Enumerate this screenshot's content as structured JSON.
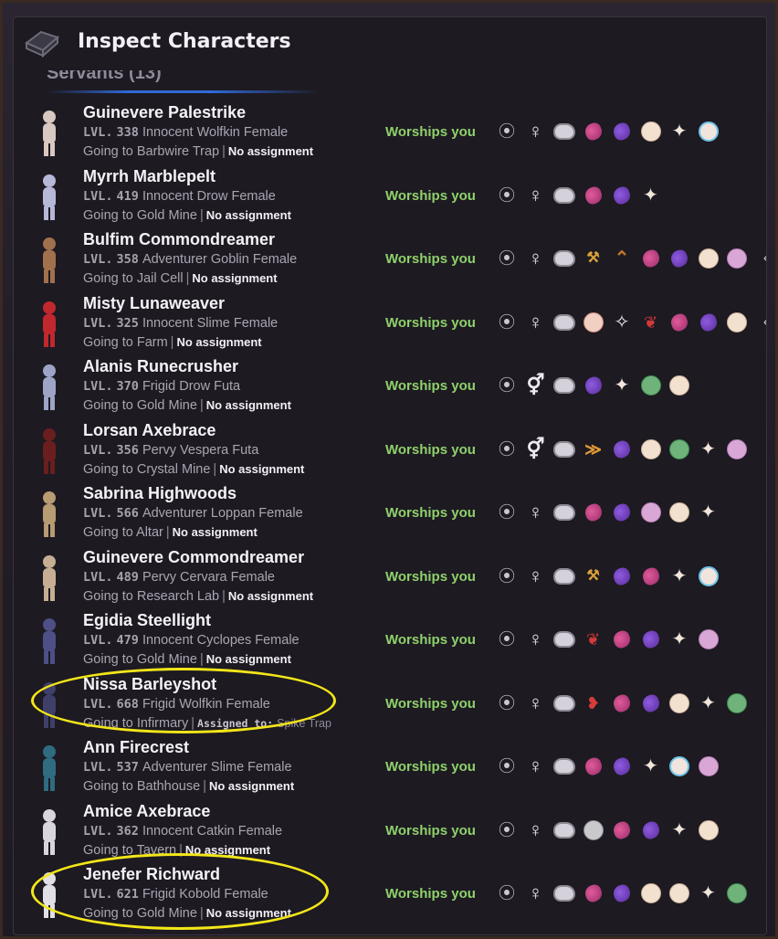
{
  "header": {
    "title": "Inspect Characters",
    "section_title": "Servants (13)"
  },
  "labels": {
    "lvl_prefix": "LVL.",
    "worships": "Worships you",
    "assigned_to_key": "Assigned to:",
    "separator": "|"
  },
  "colors": {
    "worships_green": "#8fd16a",
    "highlight_yellow": "#f3e619",
    "accent_blue": "#2f6ad8"
  },
  "servants": [
    {
      "name": "Guinevere Palestrike",
      "level": "338",
      "type": "Innocent Wolfkin Female",
      "going": "Going to Barbwire Trap",
      "assignment": "No assignment",
      "worship": "Worships you",
      "icons": [
        "mask-icon",
        "venus-icon",
        "brain-icon",
        "pink-heart-icon",
        "purple-heart-icon",
        "face-icon",
        "figure-icon",
        "crying-face-icon"
      ]
    },
    {
      "name": "Myrrh Marblepelt",
      "level": "419",
      "type": "Innocent Drow Female",
      "going": "Going to Gold Mine",
      "assignment": "No assignment",
      "worship": "Worships you",
      "icons": [
        "mask-icon",
        "venus-icon",
        "brain-icon",
        "pink-heart-icon",
        "purple-heart-icon",
        "figure-icon"
      ]
    },
    {
      "name": "Bulfim Commondreamer",
      "level": "358",
      "type": "Adventurer Goblin Female",
      "going": "Going to Jail Cell",
      "assignment": "No assignment",
      "worship": "Worships you",
      "icons": [
        "mask-icon",
        "venus-icon",
        "brain-icon",
        "axes-icon",
        "axes-chevron-icon",
        "pink-heart-icon",
        "purple-heart-icon",
        "face-icon",
        "pink-face-icon",
        "arrow-icon"
      ]
    },
    {
      "name": "Misty Lunaweaver",
      "level": "325",
      "type": "Innocent Slime Female",
      "going": "Going to Farm",
      "assignment": "No assignment",
      "worship": "Worships you",
      "icons": [
        "mask-icon",
        "venus-icon",
        "brain-icon",
        "angry-face-icon",
        "sparkle-icon",
        "rose-icon",
        "pink-heart-icon",
        "purple-heart-icon",
        "face-icon",
        "arrow-icon"
      ]
    },
    {
      "name": "Alanis Runecrusher",
      "level": "370",
      "type": "Frigid Drow Futa",
      "going": "Going to Gold Mine",
      "assignment": "No assignment",
      "worship": "Worships you",
      "icons": [
        "mask-icon",
        "futa-icon",
        "brain-icon",
        "purple-heart-icon",
        "figure-icon",
        "green-face-icon",
        "face-icon"
      ]
    },
    {
      "name": "Lorsan Axebrace",
      "level": "356",
      "type": "Pervy Vespera Futa",
      "going": "Going to Crystal Mine",
      "assignment": "No assignment",
      "worship": "Worships you",
      "icons": [
        "mask-icon",
        "futa-icon",
        "brain-icon",
        "rank-chevron-icon",
        "purple-heart-icon",
        "face-icon",
        "green-face-icon",
        "figure-icon",
        "pink-face-icon"
      ]
    },
    {
      "name": "Sabrina Highwoods",
      "level": "566",
      "type": "Adventurer Loppan Female",
      "going": "Going to Altar",
      "assignment": "No assignment",
      "worship": "Worships you",
      "icons": [
        "mask-icon",
        "venus-icon",
        "brain-icon",
        "pink-heart-icon",
        "purple-heart-icon",
        "pink-face-icon",
        "face-icon",
        "figure-icon"
      ]
    },
    {
      "name": "Guinevere Commondreamer",
      "level": "489",
      "type": "Pervy Cervara Female",
      "going": "Going to Research Lab",
      "assignment": "No assignment",
      "worship": "Worships you",
      "icons": [
        "mask-icon",
        "venus-icon",
        "brain-icon",
        "axes-icon",
        "purple-heart-icon",
        "pink-heart-icon",
        "figure-icon",
        "crying-face-icon"
      ]
    },
    {
      "name": "Egidia Steellight",
      "level": "479",
      "type": "Innocent Cyclopes Female",
      "going": "Going to Gold Mine",
      "assignment": "No assignment",
      "worship": "Worships you",
      "icons": [
        "mask-icon",
        "venus-icon",
        "brain-icon",
        "rose-icon",
        "pink-heart-icon",
        "purple-heart-icon",
        "figure-icon",
        "pink-face-icon"
      ]
    },
    {
      "name": "Nissa Barleyshot",
      "level": "668",
      "type": "Frigid Wolfkin Female",
      "going": "Going to Infirmary",
      "assignment": "Spike Trap",
      "assigned": true,
      "worship": "Worships you",
      "icons": [
        "mask-icon",
        "venus-icon",
        "brain-icon",
        "lips-icon",
        "pink-heart-icon",
        "purple-heart-icon",
        "face-icon",
        "figure-icon",
        "green-face-icon"
      ]
    },
    {
      "name": "Ann Firecrest",
      "level": "537",
      "type": "Adventurer Slime Female",
      "going": "Going to Bathhouse",
      "assignment": "No assignment",
      "worship": "Worships you",
      "icons": [
        "mask-icon",
        "venus-icon",
        "brain-icon",
        "pink-heart-icon",
        "purple-heart-icon",
        "figure-icon",
        "crying-face-icon",
        "pink-face-icon"
      ]
    },
    {
      "name": "Amice Axebrace",
      "level": "362",
      "type": "Innocent Catkin Female",
      "going": "Going to Tavern",
      "assignment": "No assignment",
      "worship": "Worships you",
      "icons": [
        "mask-icon",
        "venus-icon",
        "brain-icon",
        "gray-face-icon",
        "pink-heart-icon",
        "purple-heart-icon",
        "figure-icon",
        "face-icon"
      ]
    },
    {
      "name": "Jenefer Richward",
      "level": "621",
      "type": "Frigid Kobold Female",
      "going": "Going to Gold Mine",
      "assignment": "No assignment",
      "worship": "Worships you",
      "icons": [
        "mask-icon",
        "venus-icon",
        "brain-icon",
        "pink-heart-icon",
        "purple-heart-icon",
        "face-icon",
        "face-icon",
        "figure-icon",
        "green-face-icon"
      ]
    }
  ]
}
